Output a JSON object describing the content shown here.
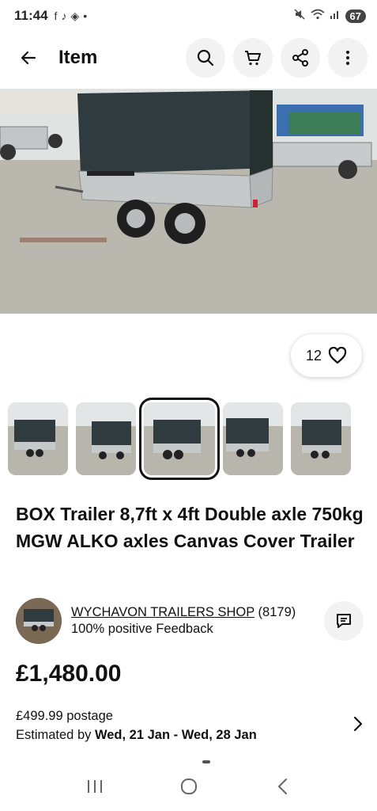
{
  "status_bar": {
    "time": "11:44",
    "battery": "67"
  },
  "app_bar": {
    "title": "Item"
  },
  "listing": {
    "watch_count": "12",
    "title": "BOX Trailer 8,7ft x 4ft Double axle 750kg MGW ALKO axles Canvas Cover Trailer",
    "price": "£1,480.00",
    "postage_price": "£499.99 postage",
    "estimated_prefix": "Estimated by ",
    "estimated_dates": "Wed, 21 Jan - Wed, 28 Jan"
  },
  "seller": {
    "name": "WYCHAVON TRAILERS SHOP",
    "score": " (8179)",
    "feedback": "100% positive Feedback"
  },
  "colors": {
    "canvas_cover": "#2f3b3f",
    "accent": "#111111",
    "button_bg": "#f2f2f2"
  }
}
